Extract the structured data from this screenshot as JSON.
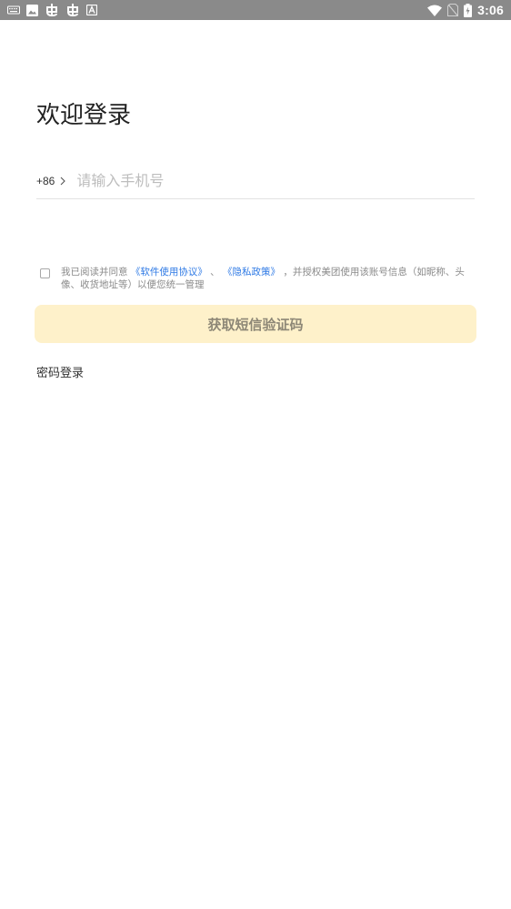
{
  "status_bar": {
    "time": "3:06",
    "left_icons": [
      "keyboard-icon",
      "image-icon",
      "bug-icon",
      "bug-icon",
      "a-icon"
    ],
    "right_icons": [
      "wifi-icon",
      "no-sim-icon",
      "battery-charging-icon"
    ],
    "background": "#8a8a8a"
  },
  "login": {
    "title": "欢迎登录",
    "country_code": "+86",
    "phone_placeholder": "请输入手机号",
    "agreement": {
      "prefix": "我已阅读并同意 ",
      "link1": "《软件使用协议》",
      "sep": " 、 ",
      "link2": "《隐私政策》",
      "suffix": " ，并授权美团使用该账号信息（如昵称、头像、收货地址等）以便您统一管理"
    },
    "cta_label": "获取短信验证码",
    "password_login": "密码登录"
  },
  "colors": {
    "accent_bg": "#fef1ca",
    "link": "#2f7ae5",
    "cta_text": "#8d8776"
  }
}
